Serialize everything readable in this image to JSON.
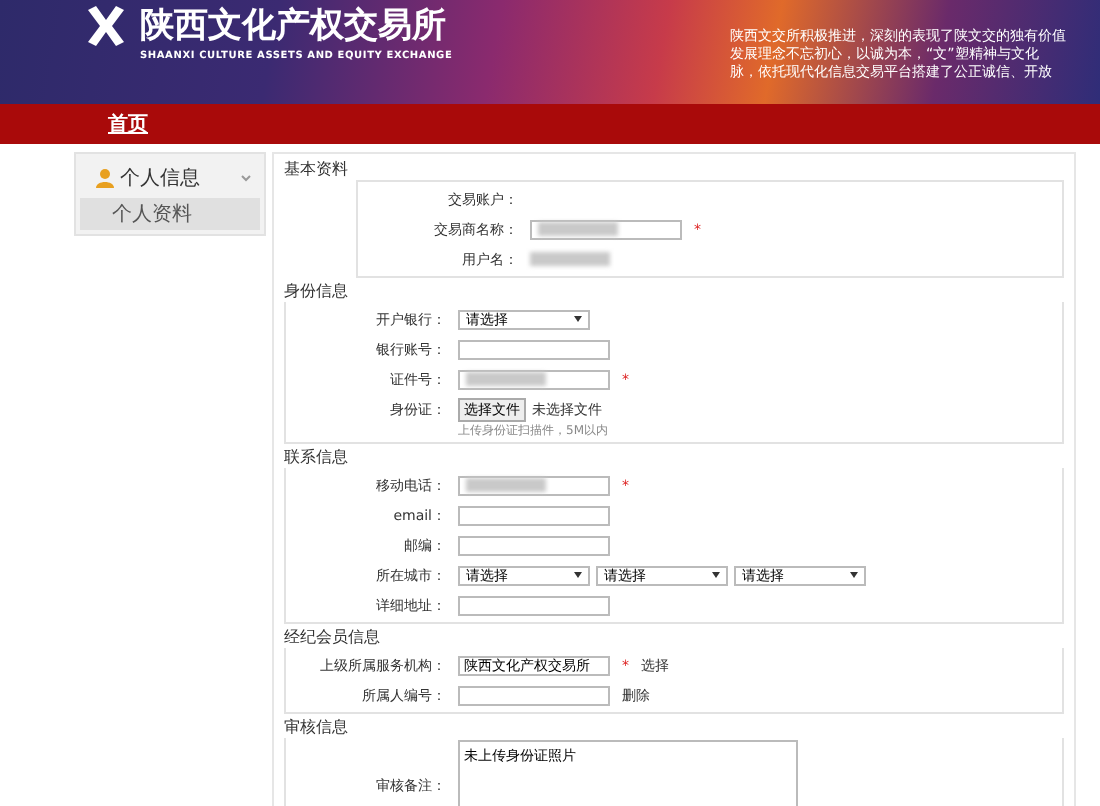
{
  "header": {
    "logo_title": "陕西文化产权交易所",
    "logo_subtitle": "SHAANXI CULTURE ASSETS AND EQUITY EXCHANGE",
    "intro_lines": [
      "陕西文交所积极推进，深刻的表现了陕文交的独有价值",
      "发展理念不忘初心，以诚为本，“文”塑精神与文化",
      "脉，依托现代化信息交易平台搭建了公正诚信、开放"
    ]
  },
  "nav": {
    "items": [
      {
        "label": "首页",
        "selected": true
      }
    ]
  },
  "sidebar": {
    "title": "个人信息",
    "expanded": true,
    "items": [
      {
        "label": "个人资料",
        "selected": true
      }
    ]
  },
  "form": {
    "title": "基本资料",
    "sections": [
      {
        "fields": [
          {
            "kind": "plain",
            "label": "交易账户："
          },
          {
            "kind": "text",
            "label": "交易商名称：",
            "redacted": true,
            "required": "*"
          },
          {
            "kind": "plain",
            "label": "用户名：",
            "redacted": true
          }
        ]
      },
      {
        "title": "身份信息",
        "fields": [
          {
            "kind": "select",
            "label": "开户银行：",
            "options": [
              "请选择"
            ]
          },
          {
            "kind": "text",
            "label": "银行账号："
          },
          {
            "kind": "text",
            "label": "证件号：",
            "redacted": true,
            "required": "*"
          },
          {
            "kind": "file",
            "label": "身份证：",
            "button": "选择文件",
            "status": "未选择文件",
            "hint": "上传身份证扫描件，5M以内"
          }
        ]
      },
      {
        "title": "联系信息",
        "fields": [
          {
            "kind": "text",
            "label": "移动电话：",
            "redacted": true,
            "required": "*"
          },
          {
            "kind": "text",
            "label": "email："
          },
          {
            "kind": "text",
            "label": "邮编："
          },
          {
            "kind": "select",
            "label": "所在城市：",
            "options": [
              "请选择",
              "请选择",
              "请选择"
            ]
          },
          {
            "kind": "text",
            "label": "详细地址："
          }
        ]
      },
      {
        "title": "经纪会员信息",
        "fields": [
          {
            "kind": "text",
            "label": "上级所属服务机构：",
            "value": "陕西文化产权交易所",
            "required": "*",
            "action": "选择"
          },
          {
            "kind": "text",
            "label": "所属人编号：",
            "action": "删除"
          }
        ]
      },
      {
        "title": "审核信息",
        "fields": [
          {
            "kind": "textarea",
            "label": "审核备注：",
            "value": "未上传身份证照片"
          }
        ]
      }
    ]
  }
}
